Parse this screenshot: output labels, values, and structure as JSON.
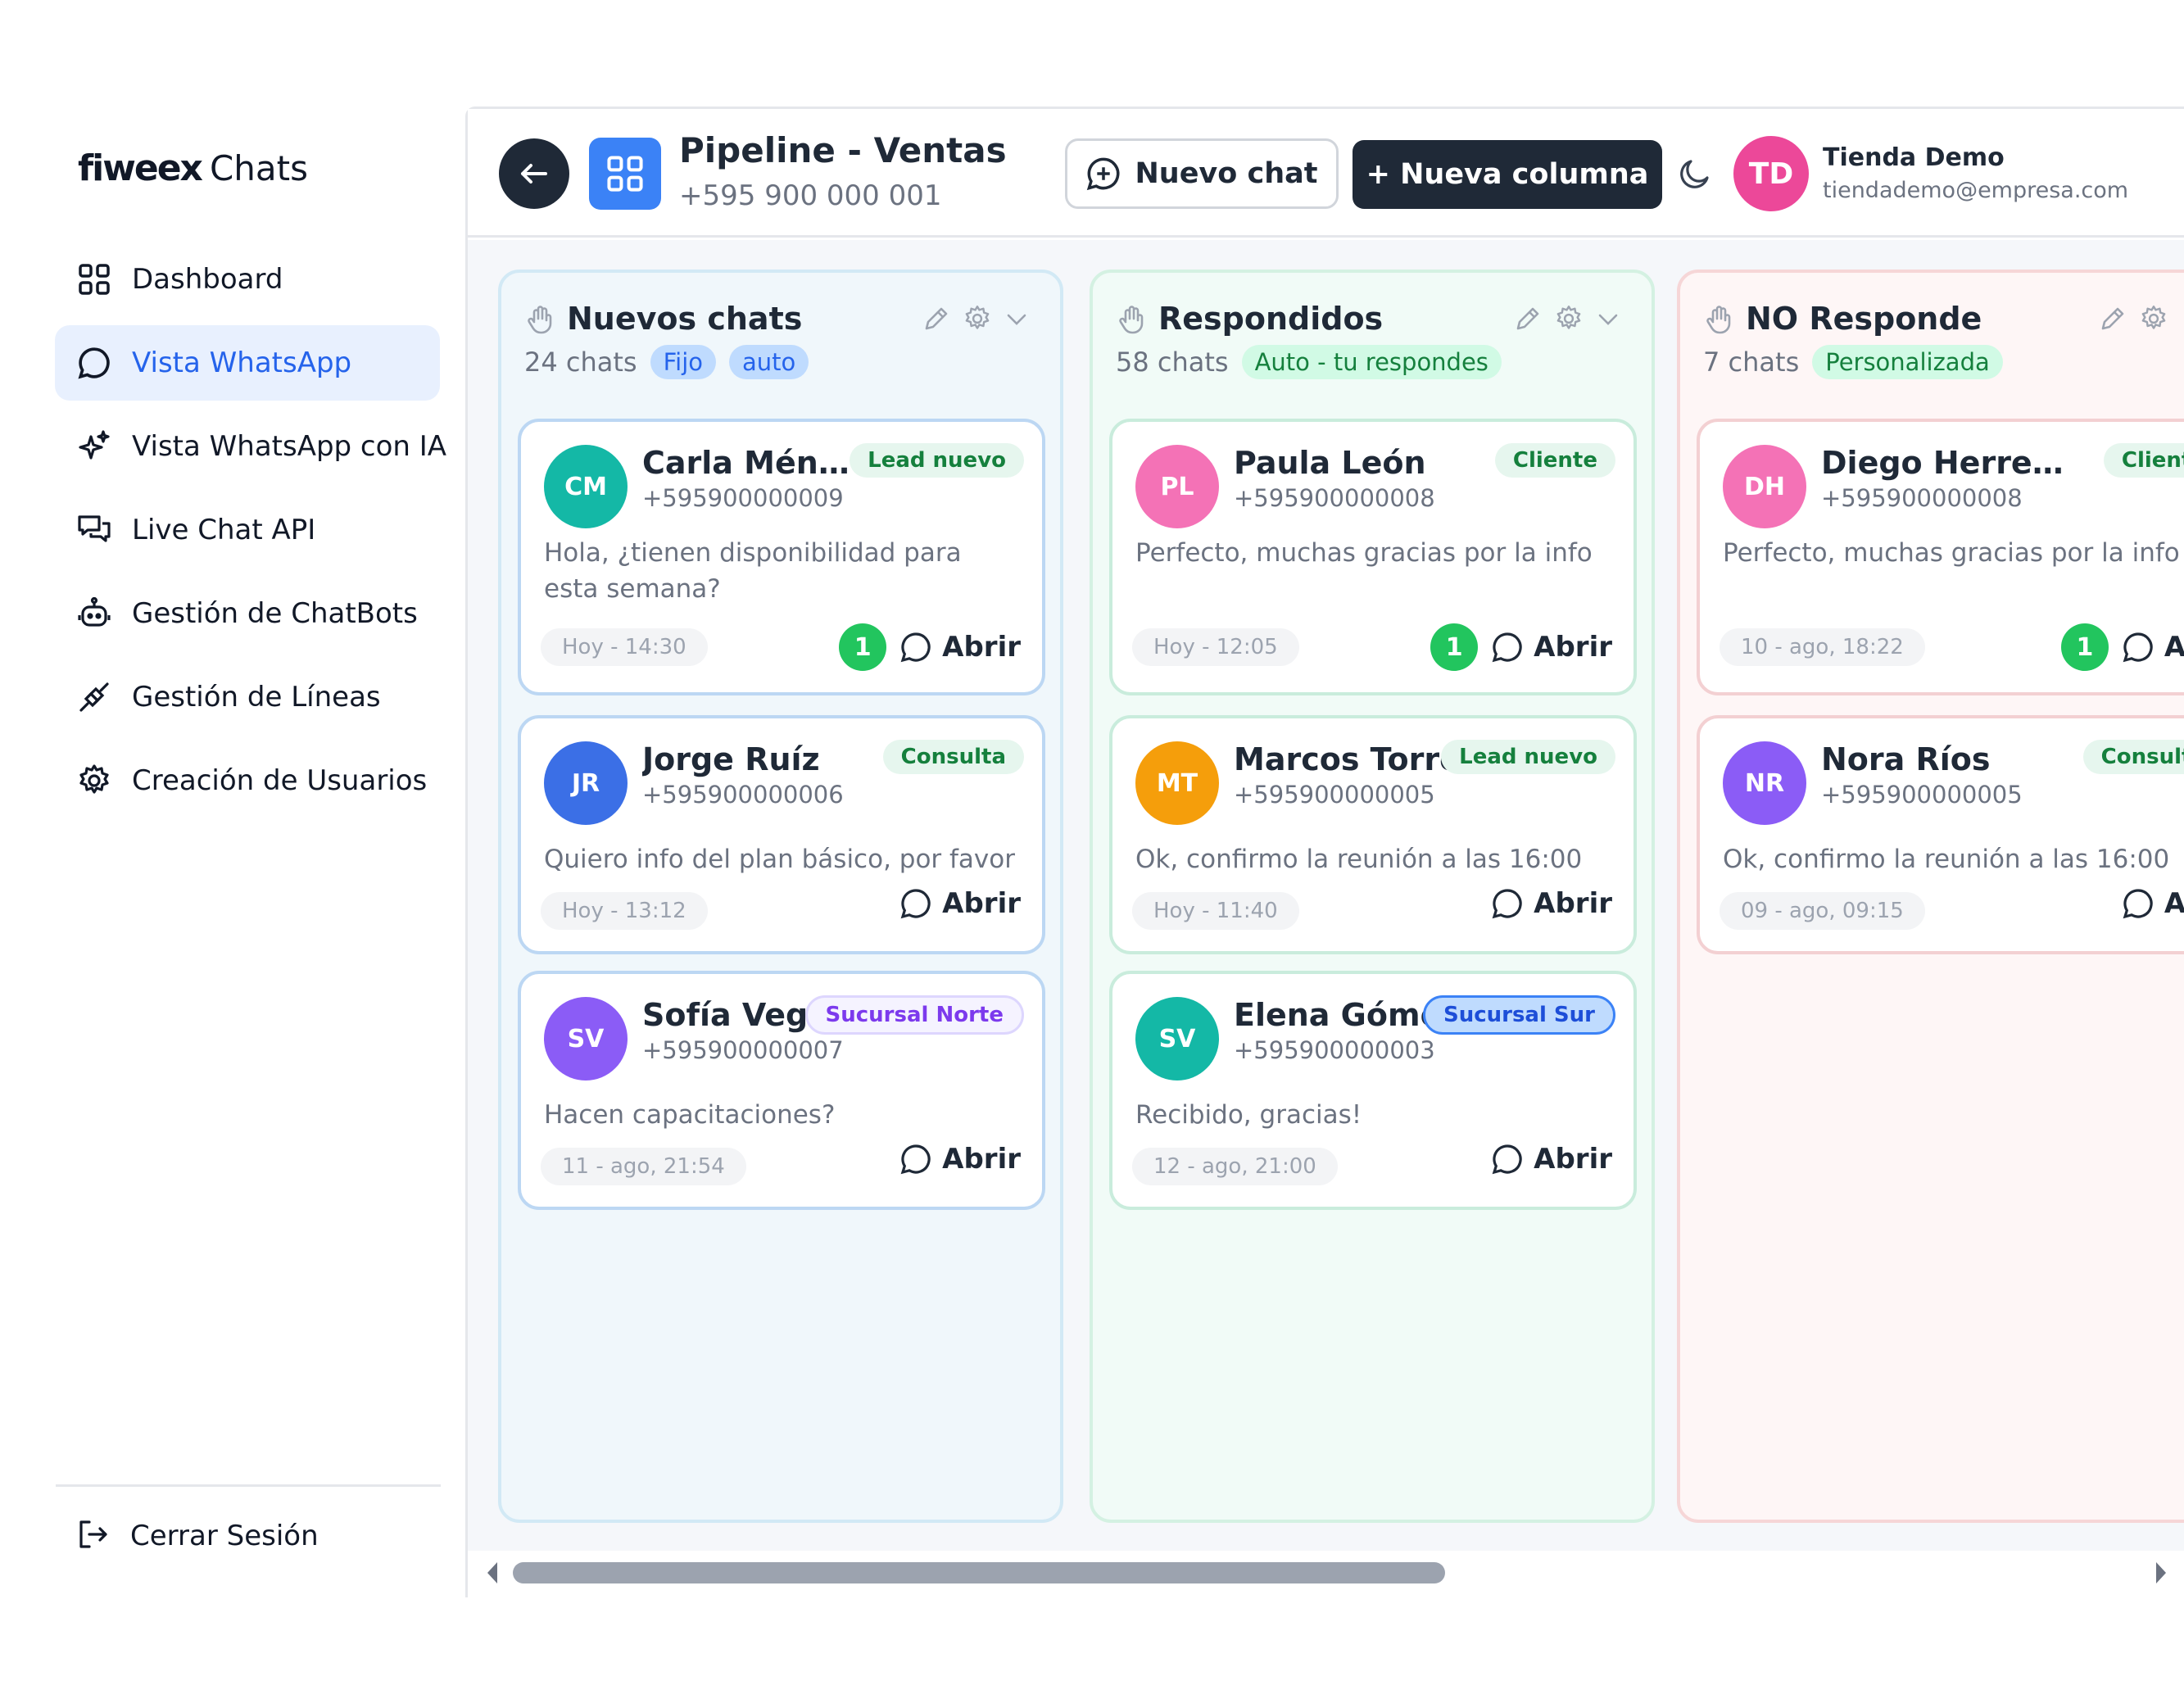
{
  "app": {
    "brand": "fiweex",
    "brand_sub": "Chats"
  },
  "sidebar": {
    "items": [
      {
        "label": "Dashboard",
        "icon": "grid-icon"
      },
      {
        "label": "Vista WhatsApp",
        "icon": "chat-bubble-icon",
        "active": true
      },
      {
        "label": "Vista WhatsApp con IA",
        "icon": "sparkle-icon"
      },
      {
        "label": "Live Chat API",
        "icon": "messages-icon"
      },
      {
        "label": "Gestión de ChatBots",
        "icon": "bot-icon"
      },
      {
        "label": "Gestión de Líneas",
        "icon": "plug-icon"
      },
      {
        "label": "Creación de Usuarios",
        "icon": "gear-icon"
      }
    ],
    "logout_label": "Cerrar Sesión"
  },
  "header": {
    "title": "Pipeline - Ventas",
    "phone": "+595 900 000 001",
    "new_chat_label": "Nuevo chat",
    "new_column_label": "+ Nueva columna",
    "user": {
      "initials": "TD",
      "name": "Tienda Demo",
      "email": "tiendademo@empresa.com"
    }
  },
  "colors": {
    "accent": "#2563eb",
    "dark": "#1f2937",
    "unread": "#22c55e"
  },
  "columns": [
    {
      "title": "Nuevos chats",
      "count": "24 chats",
      "tags": [
        "Fijo",
        "auto"
      ],
      "cards": [
        {
          "initials": "CM",
          "color": "#14b8a6",
          "name": "Carla Ménd...",
          "phone": "+595900000009",
          "badge": "Lead nuevo",
          "message": "Hola, ¿tienen disponibilidad para esta semana?",
          "time": "Hoy - 14:30",
          "unread": "1",
          "open": "Abrir"
        },
        {
          "initials": "JR",
          "color": "#3b6fe6",
          "name": "Jorge Ruíz",
          "phone": "+595900000006",
          "badge": "Consulta",
          "message": "Quiero info del plan básico, por favor",
          "time": "Hoy - 13:12",
          "open": "Abrir"
        },
        {
          "initials": "SV",
          "color": "#8b5cf6",
          "name": "Sofía Vega",
          "phone": "+595900000007",
          "badge": "Sucursal Norte",
          "message": "Hacen capacitaciones?",
          "time": "11 - ago, 21:54",
          "open": "Abrir"
        }
      ]
    },
    {
      "title": "Respondidos",
      "count": "58 chats",
      "tags": [
        "Auto - tu respondes"
      ],
      "cards": [
        {
          "initials": "PL",
          "color": "#f472b6",
          "name": "Paula León",
          "phone": "+595900000008",
          "badge": "Cliente",
          "message": "Perfecto, muchas gracias por la info",
          "time": "Hoy - 12:05",
          "unread": "1",
          "open": "Abrir"
        },
        {
          "initials": "MT",
          "color": "#f59e0b",
          "name": "Marcos Torres",
          "phone": "+595900000005",
          "badge": "Lead nuevo",
          "message": "Ok, confirmo la reunión a las 16:00",
          "time": "Hoy - 11:40",
          "open": "Abrir"
        },
        {
          "initials": "SV",
          "color": "#14b8a6",
          "name": "Elena Gómez",
          "phone": "+595900000003",
          "badge": "Sucursal Sur",
          "message": "Recibido, gracias!",
          "time": "12 - ago, 21:00",
          "open": "Abrir"
        }
      ]
    },
    {
      "title": "NO Responde",
      "count": "7 chats",
      "tags": [
        "Personalizada"
      ],
      "cards": [
        {
          "initials": "DH",
          "color": "#f472b6",
          "name": "Diego Herrera",
          "phone": "+595900000008",
          "badge": "Cliente",
          "message": "Perfecto, muchas gracias por la info",
          "time": "10 - ago, 18:22",
          "unread": "1",
          "open": "Abri"
        },
        {
          "initials": "NR",
          "color": "#8b5cf6",
          "name": "Nora Ríos",
          "phone": "+595900000005",
          "badge": "Consulta",
          "message": "Ok, confirmo la reunión a las 16:00",
          "time": "09 - ago, 09:15",
          "open": "Abri"
        }
      ]
    }
  ]
}
